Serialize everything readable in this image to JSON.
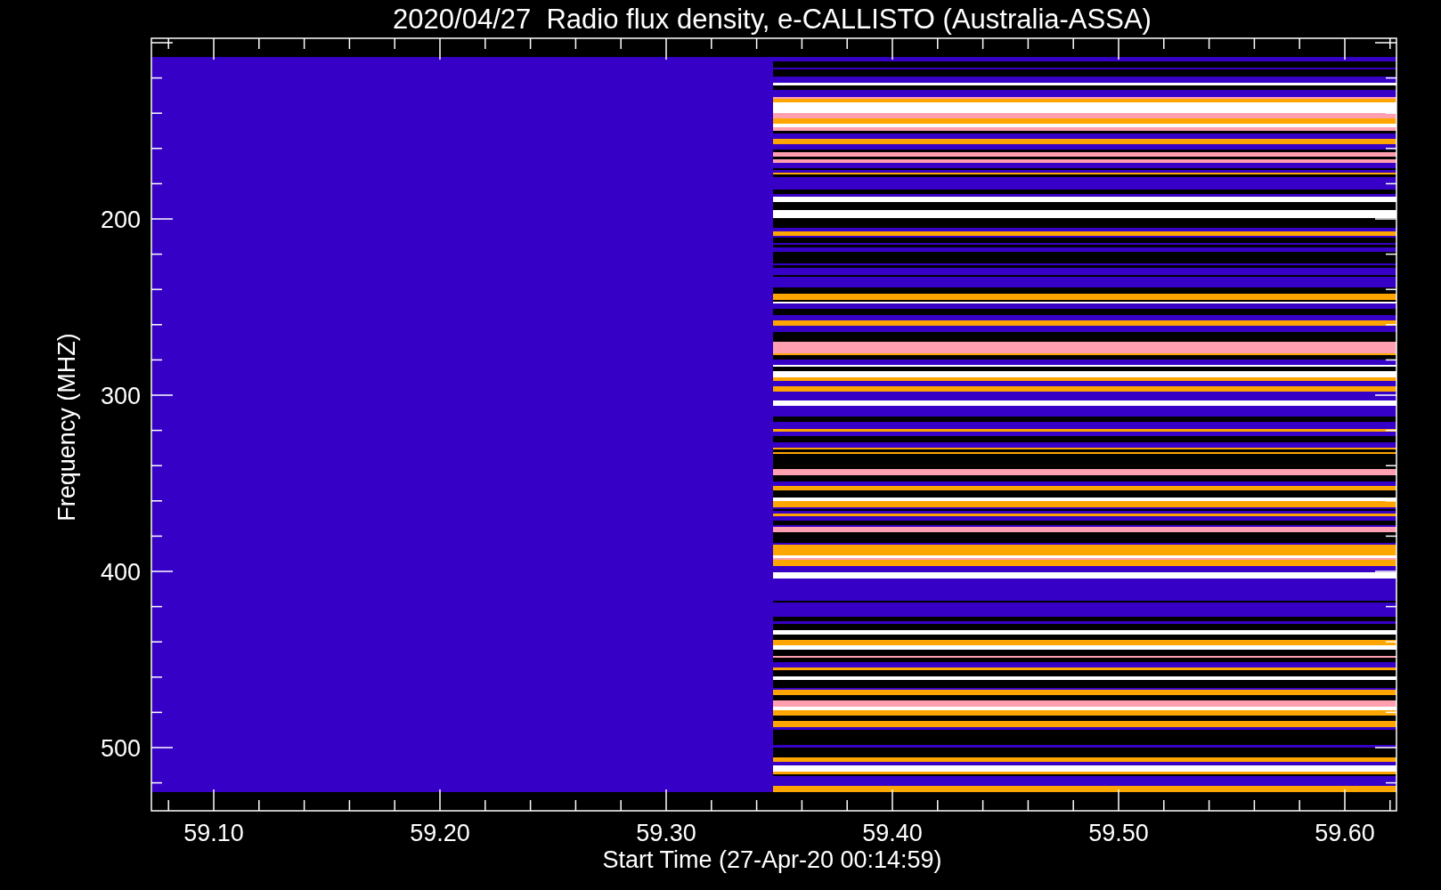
{
  "plot": {
    "title": "2020/04/27  Radio flux density, e-CALLISTO (Australia-ASSA)",
    "xlabel": "Start Time (27-Apr-20 00:14:59)",
    "ylabel": "Frequency (MHZ)",
    "yticks": [
      "200",
      "300",
      "400",
      "500"
    ],
    "xticks": [
      "59.10",
      "59.20",
      "59.30",
      "59.40",
      "59.50",
      "59.60"
    ]
  }
}
